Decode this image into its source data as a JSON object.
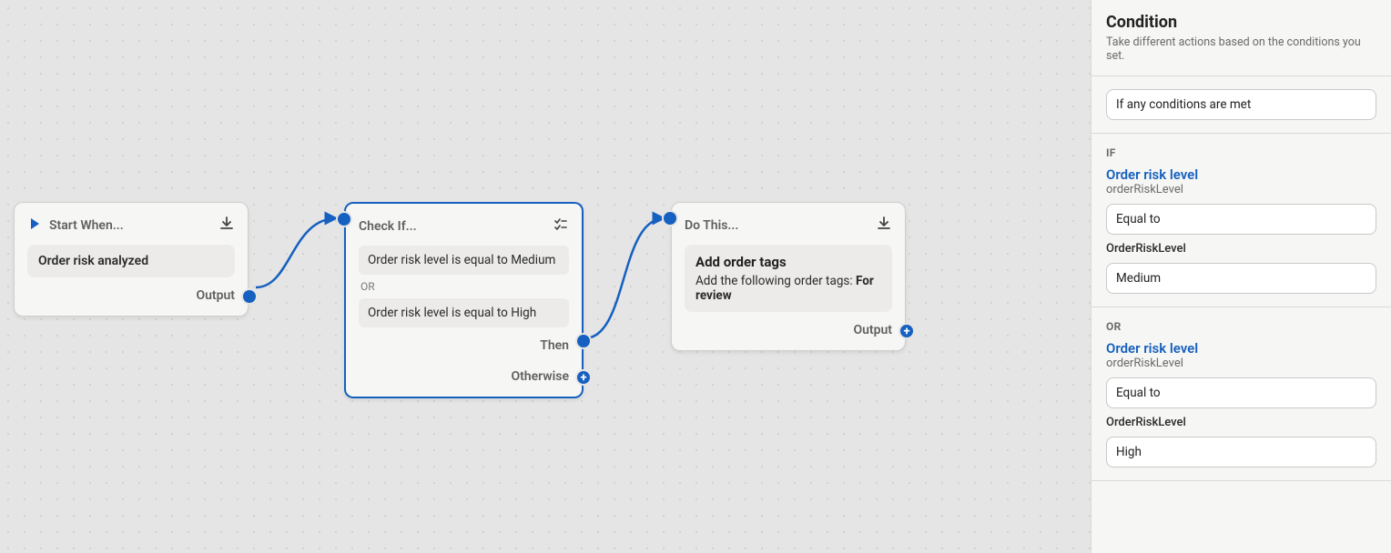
{
  "nodes": {
    "start": {
      "title": "Start When...",
      "triggerLabel": "Order risk analyzed",
      "outputLabel": "Output"
    },
    "check": {
      "title": "Check If...",
      "cond1": "Order risk level is equal to Medium",
      "orLabel": "OR",
      "cond2": "Order risk level is equal to High",
      "thenLabel": "Then",
      "otherwiseLabel": "Otherwise"
    },
    "action": {
      "title": "Do This...",
      "actionTitle": "Add order tags",
      "actionPrefix": "Add the following order tags: ",
      "actionTag": "For review",
      "outputLabel": "Output"
    }
  },
  "panel": {
    "heading": "Condition",
    "sub": "Take different actions based on the conditions you set.",
    "matchMode": "If any conditions are met",
    "ifLabel": "IF",
    "orLabel": "OR",
    "c1_link": "Order risk level",
    "c1_path": "orderRiskLevel",
    "c1_op": "Equal to",
    "c1_fieldLabel": "OrderRiskLevel",
    "c1_value": "Medium",
    "c2_link": "Order risk level",
    "c2_path": "orderRiskLevel",
    "c2_op": "Equal to",
    "c2_fieldLabel": "OrderRiskLevel",
    "c2_value": "High"
  }
}
